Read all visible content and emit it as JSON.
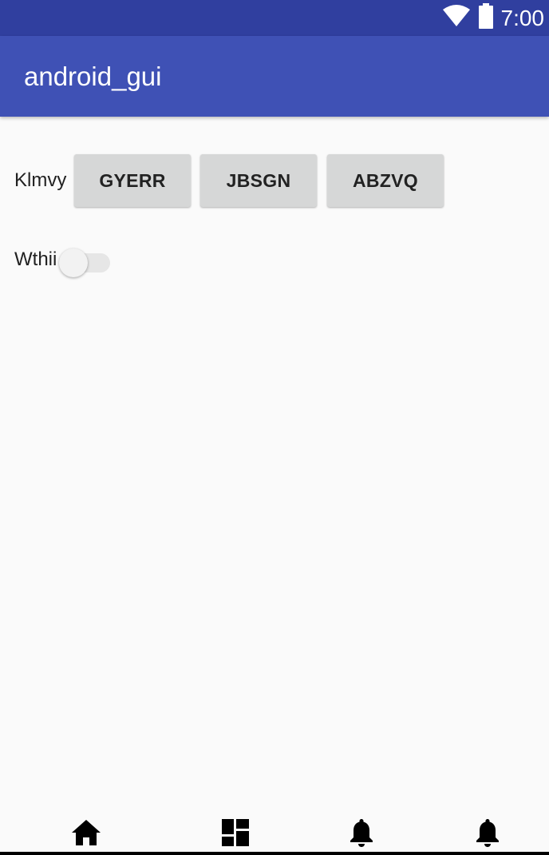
{
  "status_bar": {
    "time": "7:00",
    "wifi_icon": "wifi-icon",
    "battery_icon": "battery-icon"
  },
  "app_bar": {
    "title": "android_gui"
  },
  "main": {
    "row_label": "Klmvy",
    "buttons": [
      "GYERR",
      "JBSGN",
      "ABZVQ"
    ],
    "switch": {
      "label": "Wthii",
      "checked": false
    }
  },
  "bottom_nav": {
    "items": [
      "home-icon",
      "dashboard-icon",
      "notifications-icon",
      "notifications-icon"
    ]
  },
  "colors": {
    "status_bar": "#303f9f",
    "app_bar": "#3f51b5",
    "background": "#fafafa",
    "button": "#d6d7d7"
  }
}
